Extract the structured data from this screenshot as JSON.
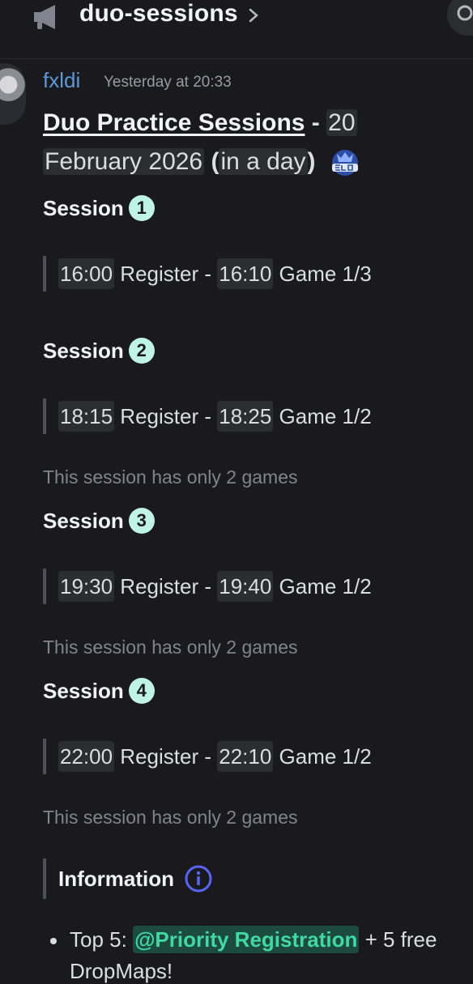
{
  "header": {
    "channel_name": "duo-sessions",
    "icons": {
      "channel": "announcement-megaphone-icon",
      "chevron": "chevron-right-icon",
      "search": "search-icon"
    }
  },
  "message": {
    "author": "fxldi",
    "author_color": "#5b9ad6",
    "timestamp": "Yesterday at 20:33",
    "title": {
      "link_text": "Duo Practice Sessions",
      "dash": " - ",
      "date_part1": "20",
      "date_part2": "February 2026",
      "paren_open": " (",
      "relative": "in a day",
      "paren_close": ")",
      "emoji": "elo-cup-emoji"
    },
    "sessions": [
      {
        "label": "Session",
        "number": "1",
        "reg_time": "16:00",
        "reg_label": " Register - ",
        "game_time": "16:10",
        "game_label": " Game 1/3",
        "note": ""
      },
      {
        "label": "Session",
        "number": "2",
        "reg_time": "18:15",
        "reg_label": " Register - ",
        "game_time": "18:25",
        "game_label": " Game 1/2",
        "note": "This session has only 2 games"
      },
      {
        "label": "Session",
        "number": "3",
        "reg_time": "19:30",
        "reg_label": " Register - ",
        "game_time": "19:40",
        "game_label": " Game 1/2",
        "note": "This session has only 2 games"
      },
      {
        "label": "Session",
        "number": "4",
        "reg_time": "22:00",
        "reg_label": " Register - ",
        "game_time": "22:10",
        "game_label": " Game 1/2",
        "note": "This session has only 2 games"
      }
    ],
    "information": {
      "label": "Information",
      "icon": "info-circle-icon",
      "bullets": [
        {
          "prefix": "Top 5: ",
          "mention": "@Priority Registration",
          "suffix": " + 5 free",
          "continuation": "DropMaps!"
        }
      ]
    },
    "colors": {
      "badge": "#bff3e3",
      "mention_text": "#3fd9a1",
      "mention_bg": "#1d4a3f",
      "info_icon": "#5865f2"
    }
  }
}
